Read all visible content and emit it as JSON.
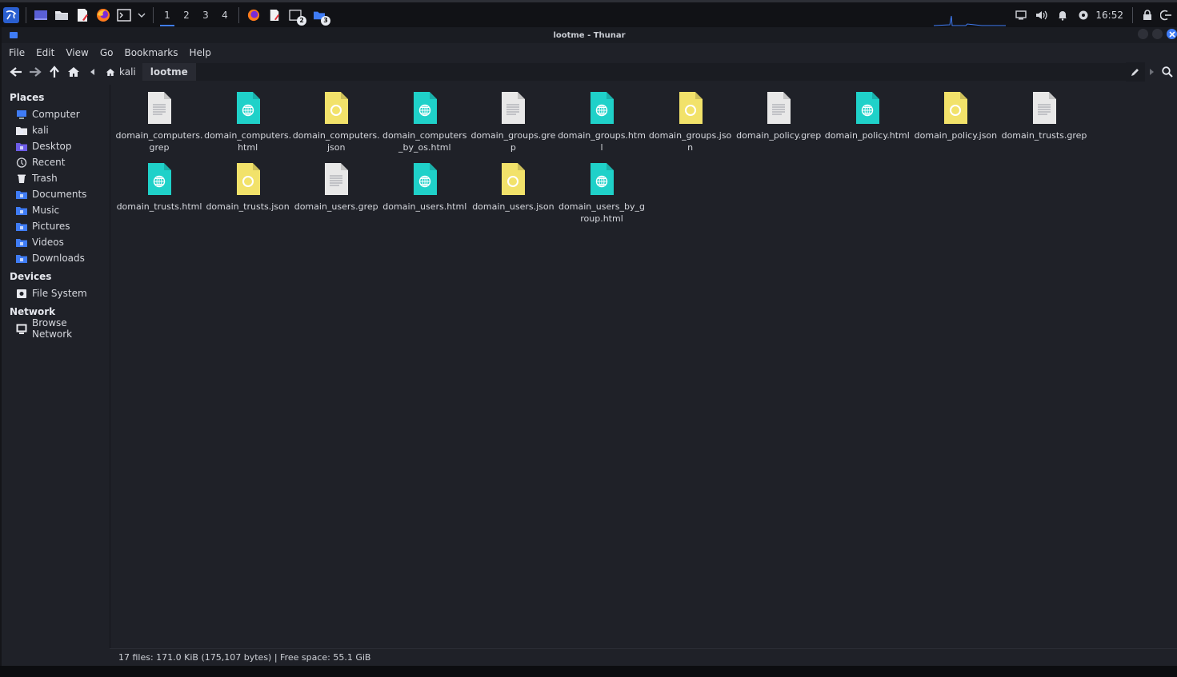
{
  "panel": {
    "workspaces": [
      {
        "label": "1",
        "active": true
      },
      {
        "label": "2",
        "active": false
      },
      {
        "label": "3",
        "active": false
      },
      {
        "label": "4",
        "active": false
      }
    ],
    "task_badge_1": "2",
    "task_badge_2": "3",
    "clock": "16:52"
  },
  "window": {
    "title": "lootme - Thunar"
  },
  "menubar": [
    "File",
    "Edit",
    "View",
    "Go",
    "Bookmarks",
    "Help"
  ],
  "path": {
    "home_label": "kali",
    "current": "lootme"
  },
  "sidebar": {
    "places_header": "Places",
    "places": [
      {
        "label": "Computer",
        "icon": "computer-icon"
      },
      {
        "label": "kali",
        "icon": "home-folder-icon"
      },
      {
        "label": "Desktop",
        "icon": "desktop-folder-icon"
      },
      {
        "label": "Recent",
        "icon": "recent-icon"
      },
      {
        "label": "Trash",
        "icon": "trash-icon"
      },
      {
        "label": "Documents",
        "icon": "documents-folder-icon"
      },
      {
        "label": "Music",
        "icon": "music-folder-icon"
      },
      {
        "label": "Pictures",
        "icon": "pictures-folder-icon"
      },
      {
        "label": "Videos",
        "icon": "videos-folder-icon"
      },
      {
        "label": "Downloads",
        "icon": "downloads-folder-icon"
      }
    ],
    "devices_header": "Devices",
    "devices": [
      {
        "label": "File System",
        "icon": "drive-icon"
      }
    ],
    "network_header": "Network",
    "network": [
      {
        "label": "Browse Network",
        "icon": "network-icon"
      }
    ]
  },
  "files": [
    {
      "name": "domain_computers.\ngrep",
      "type": "text"
    },
    {
      "name": "domain_computers.\nhtml",
      "type": "html"
    },
    {
      "name": "domain_computers.\njson",
      "type": "json"
    },
    {
      "name": "domain_computers\n_by_os.html",
      "type": "html"
    },
    {
      "name": "domain_groups.gre\np",
      "type": "text"
    },
    {
      "name": "domain_groups.htm\nl",
      "type": "html"
    },
    {
      "name": "domain_groups.json",
      "type": "json"
    },
    {
      "name": "domain_policy.grep",
      "type": "text"
    },
    {
      "name": "domain_policy.html",
      "type": "html"
    },
    {
      "name": "domain_policy.json",
      "type": "json"
    },
    {
      "name": "domain_trusts.grep",
      "type": "text"
    },
    {
      "name": "domain_trusts.html",
      "type": "html"
    },
    {
      "name": "domain_trusts.json",
      "type": "json"
    },
    {
      "name": "domain_users.grep",
      "type": "text"
    },
    {
      "name": "domain_users.html",
      "type": "html"
    },
    {
      "name": "domain_users.json",
      "type": "json"
    },
    {
      "name": "domain_users_by_g\nroup.html",
      "type": "html"
    }
  ],
  "status": "17 files: 171.0 KiB (175,107 bytes)  |  Free space: 55.1 GiB",
  "colors": {
    "accent": "#3f7cf5",
    "html_icon": "#1fd1c9",
    "json_icon": "#f2e26a",
    "text_icon": "#e8e8e8"
  }
}
